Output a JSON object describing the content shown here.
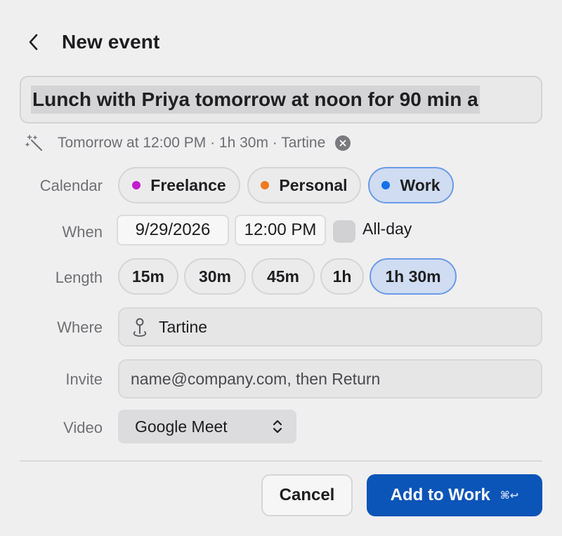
{
  "header": {
    "title": "New event"
  },
  "nl_input": {
    "value": "Lunch with Priya tomorrow at noon for 90 min a"
  },
  "parse": {
    "summary": "Tomorrow at 12:00 PM · 1h 30m · Tartine"
  },
  "calendar": {
    "label": "Calendar",
    "options": [
      {
        "name": "Freelance",
        "color": "#c41bd1"
      },
      {
        "name": "Personal",
        "color": "#f07a1e"
      },
      {
        "name": "Work",
        "color": "#1671e8"
      }
    ],
    "selected": "Work"
  },
  "when": {
    "label": "When",
    "date": "9/29/2026",
    "time": "12:00 PM",
    "allday_label": "All-day"
  },
  "length": {
    "label": "Length",
    "options": [
      "15m",
      "30m",
      "45m",
      "1h",
      "1h 30m"
    ],
    "selected": "1h 30m"
  },
  "where": {
    "label": "Where",
    "value": "Tartine"
  },
  "invite": {
    "label": "Invite",
    "placeholder": "name@company.com, then Return"
  },
  "video": {
    "label": "Video",
    "selected": "Google Meet"
  },
  "footer": {
    "cancel_label": "Cancel",
    "primary_label": "Add to Work",
    "shortcut": "⌘↩"
  },
  "colors": {
    "accent": "#0b54b8",
    "selected_fill": "#cfdcf2",
    "selected_border": "#6b9ae6"
  }
}
